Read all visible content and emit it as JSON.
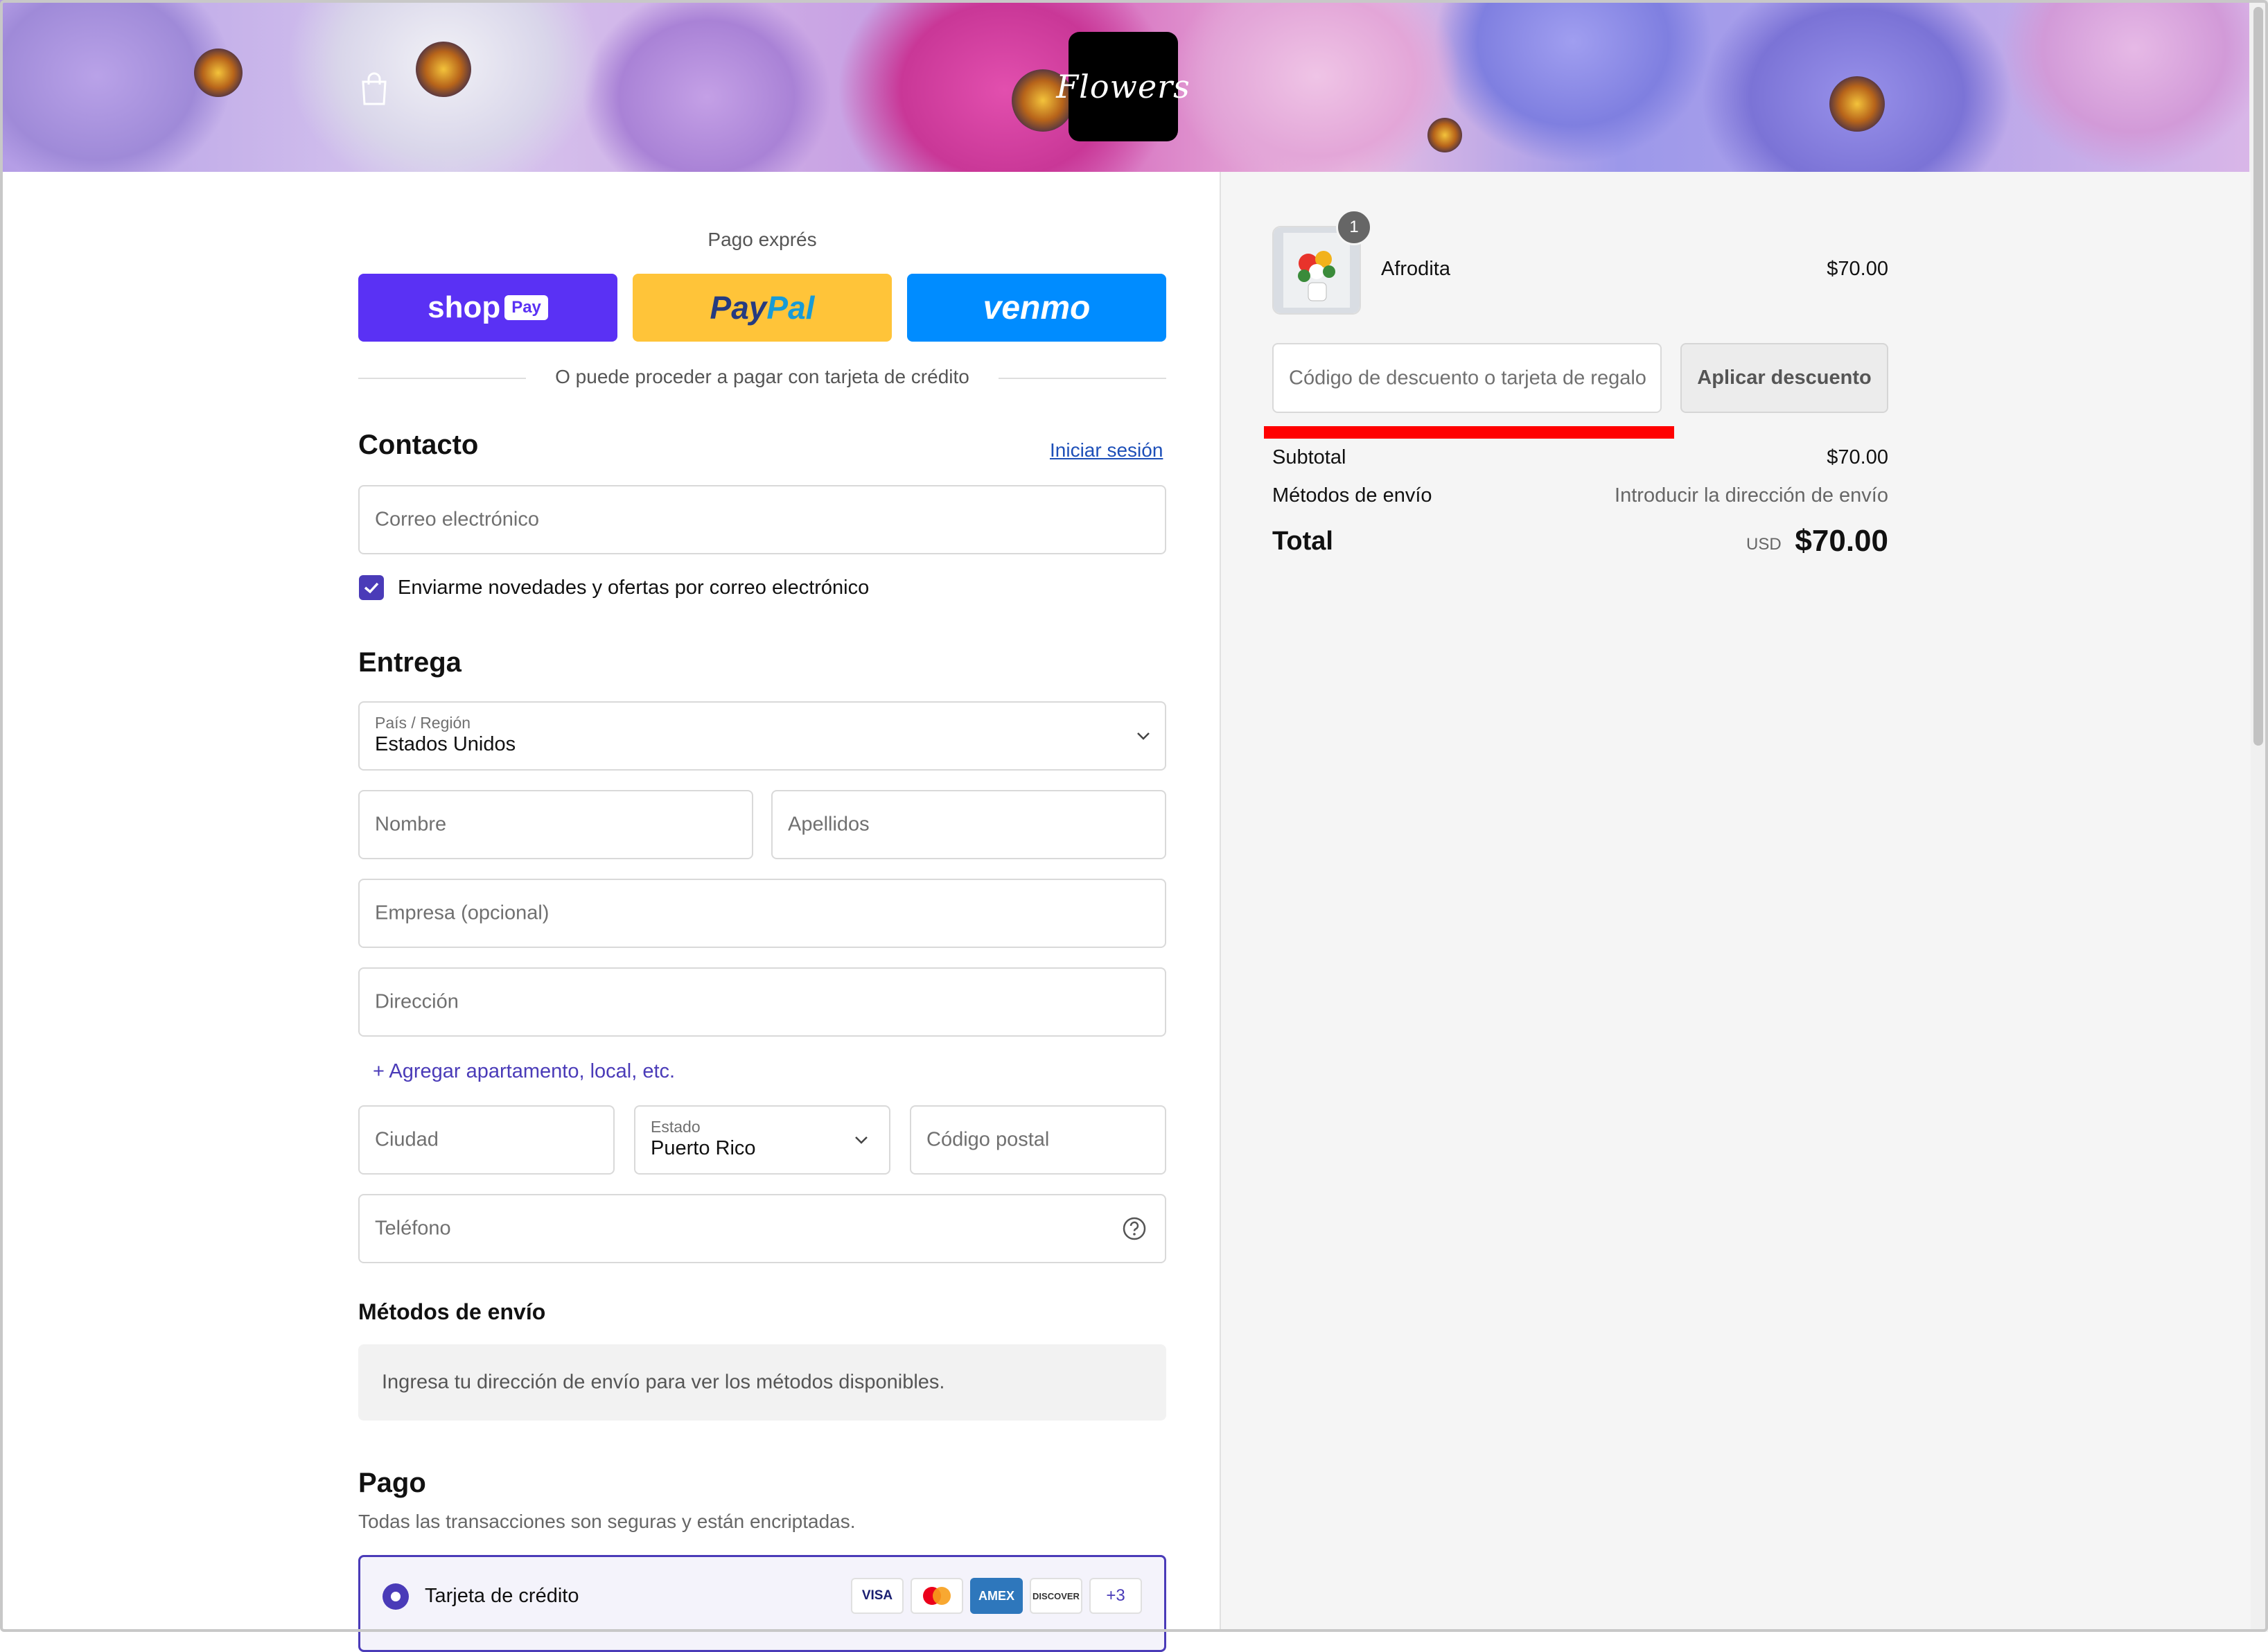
{
  "header": {
    "cart_icon": "shopping-bag-icon",
    "logo_text": "Flowers"
  },
  "express": {
    "title": "Pago exprés",
    "shop_pay": {
      "brand": "shop",
      "tag": "Pay",
      "color": "#5a31f4"
    },
    "paypal": {
      "brand_pay": "Pay",
      "brand_pal": "Pal",
      "color": "#ffc439"
    },
    "venmo": {
      "brand": "venmo",
      "color": "#008cff"
    },
    "divider_text": "O puede proceder a pagar con tarjeta de crédito"
  },
  "contact": {
    "heading": "Contacto",
    "login_link": "Iniciar sesión",
    "email_placeholder": "Correo electrónico",
    "newsletter_label": "Enviarme novedades y ofertas por correo electrónico",
    "newsletter_checked": true
  },
  "delivery": {
    "heading": "Entrega",
    "country_label": "País / Región",
    "country_value": "Estados Unidos",
    "first_name_placeholder": "Nombre",
    "last_name_placeholder": "Apellidos",
    "company_placeholder": "Empresa (opcional)",
    "address_placeholder": "Dirección",
    "add_apartment_link": "+ Agregar apartamento, local, etc.",
    "city_placeholder": "Ciudad",
    "state_label": "Estado",
    "state_value": "Puerto Rico",
    "zip_placeholder": "Código postal",
    "phone_placeholder": "Teléfono",
    "help_icon": "question-circle-icon"
  },
  "shipping": {
    "heading": "Métodos de envío",
    "info": "Ingresa tu dirección de envío para ver los métodos disponibles."
  },
  "payment": {
    "heading": "Pago",
    "subtitle": "Todas las transacciones son seguras y están encriptadas.",
    "option_label": "Tarjeta de crédito",
    "cards": [
      "VISA",
      "Mastercard",
      "AMEX",
      "DISCOVER",
      "+3"
    ],
    "accent": "#4a3bb8"
  },
  "summary": {
    "item_name": "Afrodita",
    "item_qty": "1",
    "item_price": "$70.00",
    "discount_placeholder": "Código de descuento o tarjeta de regalo",
    "apply_button": "Aplicar descuento",
    "subtotal_label": "Subtotal",
    "subtotal_value": "$70.00",
    "shipping_label": "Métodos de envío",
    "shipping_value": "Introducir la dirección de envío",
    "total_label": "Total",
    "currency": "USD",
    "total_value": "$70.00",
    "highlight_color": "#ff0000"
  }
}
